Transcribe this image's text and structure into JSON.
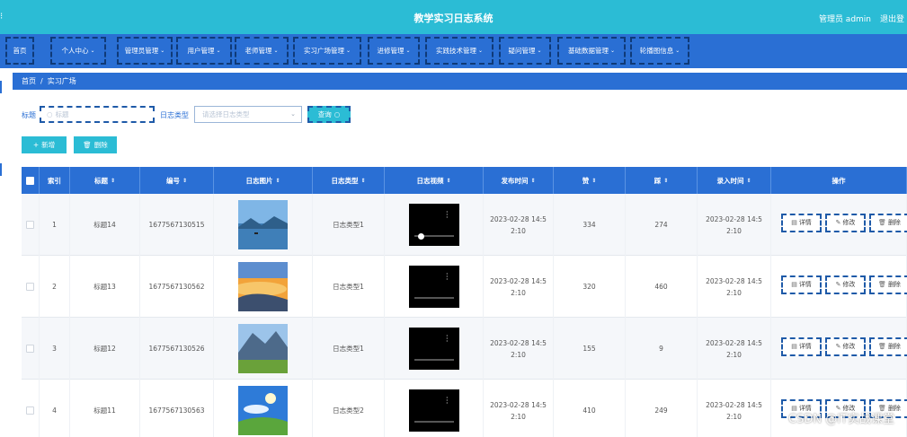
{
  "header": {
    "title": "教学实习日志系统",
    "user": "管理员 admin",
    "logout": "退出登"
  },
  "nav": [
    {
      "label": "首页",
      "has_dropdown": false
    },
    {
      "label": "个人中心",
      "has_dropdown": true
    },
    {
      "label": "管理员管理",
      "has_dropdown": true
    },
    {
      "label": "用户管理",
      "has_dropdown": true
    },
    {
      "label": "老师管理",
      "has_dropdown": true
    },
    {
      "label": "实习广场管理",
      "has_dropdown": true
    },
    {
      "label": "进修管理",
      "has_dropdown": true
    },
    {
      "label": "实践技术管理",
      "has_dropdown": true
    },
    {
      "label": "疑问管理",
      "has_dropdown": true
    },
    {
      "label": "基础数据管理",
      "has_dropdown": true
    },
    {
      "label": "轮播图信息",
      "has_dropdown": true
    }
  ],
  "breadcrumb": {
    "home": "首页",
    "separator": "/",
    "current": "实习广场"
  },
  "search": {
    "title_label": "标题",
    "title_placeholder": "标题",
    "type_label": "日志类型",
    "type_placeholder": "请选择日志类型",
    "query_button": "查询",
    "add_button": "新增",
    "delete_button": "删除"
  },
  "table": {
    "columns": [
      "索引",
      "标题",
      "编号",
      "日志图片",
      "日志类型",
      "日志视频",
      "发布时间",
      "赞",
      "踩",
      "录入时间",
      "操作"
    ],
    "rows": [
      {
        "index": "1",
        "title": "标题14",
        "number": "1677567130515",
        "type": "日志类型1",
        "publish_time": "2023-02-28 14:52:10",
        "likes": "334",
        "dislikes": "274",
        "entry_time": "2023-02-28 14:52:10",
        "image": "lake"
      },
      {
        "index": "2",
        "title": "标题13",
        "number": "1677567130562",
        "type": "日志类型1",
        "publish_time": "2023-02-28 14:52:10",
        "likes": "320",
        "dislikes": "460",
        "entry_time": "2023-02-28 14:52:10",
        "image": "sunset"
      },
      {
        "index": "3",
        "title": "标题12",
        "number": "1677567130526",
        "type": "日志类型1",
        "publish_time": "2023-02-28 14:52:10",
        "likes": "155",
        "dislikes": "9",
        "entry_time": "2023-02-28 14:52:10",
        "image": "mountain"
      },
      {
        "index": "4",
        "title": "标题11",
        "number": "1677567130563",
        "type": "日志类型2",
        "publish_time": "2023-02-28 14:52:10",
        "likes": "410",
        "dislikes": "249",
        "entry_time": "2023-02-28 14:52:10",
        "image": "sky"
      }
    ],
    "actions": {
      "detail": "详情",
      "edit": "修改",
      "delete": "删除"
    }
  },
  "watermark": "CSDN @IT实战课堂",
  "colors": {
    "header": "#2bbcd5",
    "nav": "#2a6fd4",
    "accent": "#2bbcd5"
  }
}
